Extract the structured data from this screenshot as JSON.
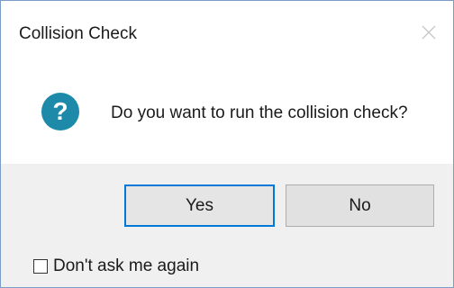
{
  "window": {
    "title": "Collision Check",
    "close_icon": "close-icon"
  },
  "message": {
    "icon": "question-icon",
    "icon_color": "#1e8aaa",
    "icon_glyph": "?",
    "text": "Do you want to run the collision check?"
  },
  "buttons": {
    "yes_label": "Yes",
    "no_label": "No",
    "default_focus_color": "#0078d7"
  },
  "options": {
    "dont_ask_label": "Don't ask me again",
    "dont_ask_checked": false
  }
}
